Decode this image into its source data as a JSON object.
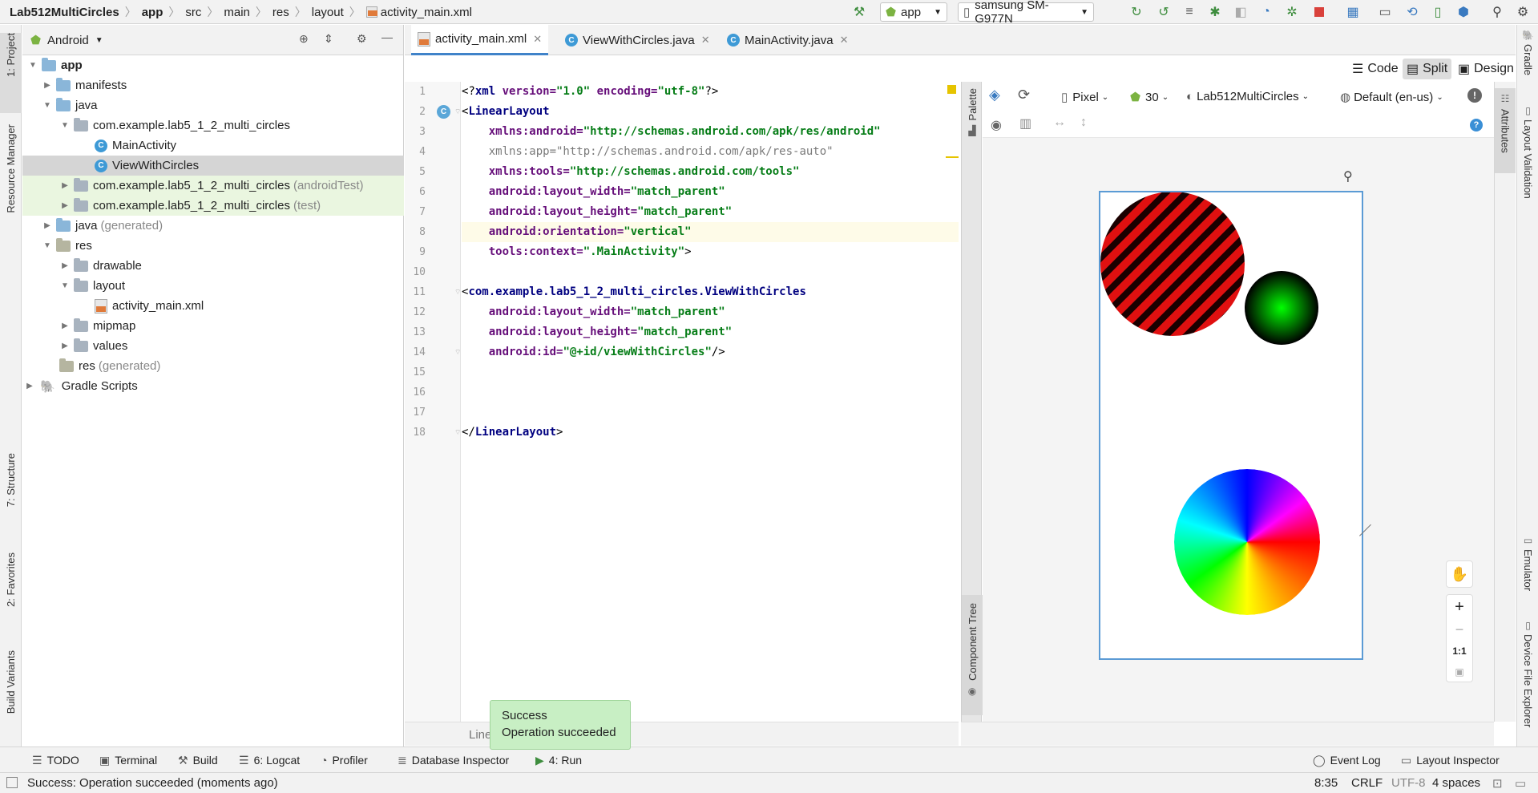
{
  "breadcrumb": {
    "items": [
      "Lab512MultiCircles",
      "app",
      "src",
      "main",
      "res",
      "layout",
      "activity_main.xml"
    ]
  },
  "run_config": {
    "module": "app",
    "device": "samsung SM-G977N"
  },
  "left_tabs": {
    "project": "1: Project",
    "resource_manager": "Resource Manager",
    "structure": "7: Structure",
    "favorites": "2: Favorites",
    "build_variants": "Build Variants"
  },
  "right_tabs": {
    "gradle": "Gradle",
    "layout_validation": "Layout Validation",
    "emulator": "Emulator",
    "device_file_explorer": "Device File Explorer"
  },
  "project_panel": {
    "view_mode": "Android",
    "tree": [
      {
        "label": "app",
        "suffix": ""
      },
      {
        "label": "manifests",
        "suffix": ""
      },
      {
        "label": "java",
        "suffix": ""
      },
      {
        "label": "com.example.lab5_1_2_multi_circles",
        "suffix": ""
      },
      {
        "label": "MainActivity",
        "suffix": ""
      },
      {
        "label": "ViewWithCircles",
        "suffix": ""
      },
      {
        "label": "com.example.lab5_1_2_multi_circles",
        "suffix": "(androidTest)"
      },
      {
        "label": "com.example.lab5_1_2_multi_circles",
        "suffix": "(test)"
      },
      {
        "label": "java",
        "suffix": "(generated)"
      },
      {
        "label": "res",
        "suffix": ""
      },
      {
        "label": "drawable",
        "suffix": ""
      },
      {
        "label": "layout",
        "suffix": ""
      },
      {
        "label": "activity_main.xml",
        "suffix": ""
      },
      {
        "label": "mipmap",
        "suffix": ""
      },
      {
        "label": "values",
        "suffix": ""
      },
      {
        "label": "res",
        "suffix": "(generated)"
      },
      {
        "label": "Gradle Scripts",
        "suffix": ""
      }
    ]
  },
  "editor_tabs": [
    "activity_main.xml",
    "ViewWithCircles.java",
    "MainActivity.java"
  ],
  "view_modes": {
    "code": "Code",
    "split": "Split",
    "design": "Design"
  },
  "code_lines": [
    {
      "n": "1",
      "parts": [
        [
          "pi",
          "<?"
        ],
        [
          "tag",
          "xml "
        ],
        [
          "attr",
          "version="
        ],
        [
          "val",
          "\"1.0\" "
        ],
        [
          "attr",
          "encoding="
        ],
        [
          "val",
          "\"utf-8\""
        ],
        [
          "pi",
          "?>"
        ]
      ]
    },
    {
      "n": "2",
      "parts": [
        [
          "pi",
          "<"
        ],
        [
          "tag",
          "LinearLayout"
        ]
      ]
    },
    {
      "n": "3",
      "parts": [
        [
          "pi",
          "    "
        ],
        [
          "attr",
          "xmlns:android="
        ],
        [
          "val",
          "\"http://schemas.android.com/apk/res/android\""
        ]
      ]
    },
    {
      "n": "4",
      "parts": [
        [
          "pi",
          "    "
        ],
        [
          "attrg",
          "xmlns:app=\"http://schemas.android.com/apk/res-auto\""
        ]
      ]
    },
    {
      "n": "5",
      "parts": [
        [
          "pi",
          "    "
        ],
        [
          "attr",
          "xmlns:tools="
        ],
        [
          "val",
          "\"http://schemas.android.com/tools\""
        ]
      ]
    },
    {
      "n": "6",
      "parts": [
        [
          "pi",
          "    "
        ],
        [
          "attr",
          "android:layout_width="
        ],
        [
          "val",
          "\"match_parent\""
        ]
      ]
    },
    {
      "n": "7",
      "parts": [
        [
          "pi",
          "    "
        ],
        [
          "attr",
          "android:layout_height="
        ],
        [
          "val",
          "\"match_parent\""
        ]
      ]
    },
    {
      "n": "8",
      "parts": [
        [
          "pi",
          "    "
        ],
        [
          "attr",
          "android:orientation="
        ],
        [
          "val",
          "\"vertical\""
        ]
      ]
    },
    {
      "n": "9",
      "parts": [
        [
          "pi",
          "    "
        ],
        [
          "attr",
          "tools:context="
        ],
        [
          "val",
          "\".MainActivity\""
        ],
        [
          "pi",
          ">"
        ]
      ]
    },
    {
      "n": "10",
      "parts": []
    },
    {
      "n": "11",
      "parts": [
        [
          "pi",
          "<"
        ],
        [
          "tag",
          "com.example.lab5_1_2_multi_circles.ViewWithCircles"
        ]
      ]
    },
    {
      "n": "12",
      "parts": [
        [
          "pi",
          "    "
        ],
        [
          "attr",
          "android:layout_width="
        ],
        [
          "val",
          "\"match_parent\""
        ]
      ]
    },
    {
      "n": "13",
      "parts": [
        [
          "pi",
          "    "
        ],
        [
          "attr",
          "android:layout_height="
        ],
        [
          "val",
          "\"match_parent\""
        ]
      ]
    },
    {
      "n": "14",
      "parts": [
        [
          "pi",
          "    "
        ],
        [
          "attr",
          "android:id="
        ],
        [
          "val",
          "\"@+id/viewWithCircles\""
        ],
        [
          "pi",
          "/>"
        ]
      ]
    },
    {
      "n": "15",
      "parts": []
    },
    {
      "n": "16",
      "parts": []
    },
    {
      "n": "17",
      "parts": []
    },
    {
      "n": "18",
      "parts": [
        [
          "pi",
          "</"
        ],
        [
          "tag",
          "LinearLayout"
        ],
        [
          "pi",
          ">"
        ]
      ]
    }
  ],
  "design_toolbar": {
    "device": "Pixel",
    "api": "30",
    "theme": "Lab512MultiCircles",
    "locale": "Default (en-us)"
  },
  "side_panels": {
    "palette": "Palette",
    "component_tree": "Component Tree",
    "attributes": "Attributes"
  },
  "zoom": {
    "actual": "1:1",
    "plus": "+",
    "minus": "−"
  },
  "editor_status_stub": "Line",
  "toast": {
    "title": "Success",
    "message": "Operation succeeded"
  },
  "bottom_tools": {
    "todo": "TODO",
    "terminal": "Terminal",
    "build": "Build",
    "logcat": "6: Logcat",
    "profiler": "Profiler",
    "database_inspector": "Database Inspector",
    "run": "4: Run",
    "event_log": "Event Log",
    "layout_inspector": "Layout Inspector"
  },
  "status": {
    "message": "Success: Operation succeeded (moments ago)",
    "position": "8:35",
    "line_sep": "CRLF",
    "encoding": "UTF-8",
    "indent": "4 spaces"
  },
  "colors": {
    "accent": "#4083c9",
    "toast_bg": "#c8efc4",
    "selection": "#d5d5d5",
    "test_bg": "#eaf6e0"
  }
}
